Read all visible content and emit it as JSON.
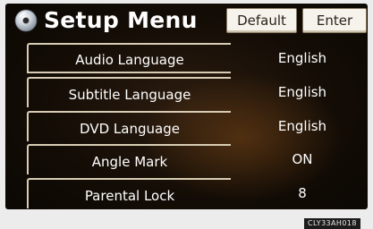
{
  "header": {
    "title": "Setup Menu",
    "default_label": "Default",
    "enter_label": "Enter",
    "title_icon": "disc-icon"
  },
  "menu": {
    "items": [
      {
        "label": "Audio Language",
        "value": "English",
        "selected": true
      },
      {
        "label": "Subtitle Language",
        "value": "English",
        "selected": false
      },
      {
        "label": "DVD Language",
        "value": "English",
        "selected": false
      },
      {
        "label": "Angle Mark",
        "value": "ON",
        "selected": false
      },
      {
        "label": "Parental Lock",
        "value": "8",
        "selected": false
      }
    ]
  },
  "footer": {
    "code": "CLY33AH018"
  },
  "colors": {
    "background": "#140d06",
    "text": "#ffffff",
    "button_face": "#f6f3ec",
    "item_border": "#d8cdb4"
  }
}
